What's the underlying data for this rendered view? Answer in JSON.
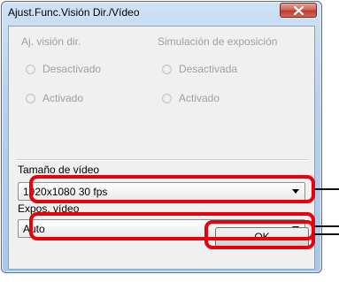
{
  "window": {
    "title": "Ajust.Func.Visión Dir./Vídeo",
    "close_icon": "close-icon"
  },
  "aj_vision": {
    "label": "Aj. visión dir.",
    "options": [
      "Desactivado",
      "Activado"
    ],
    "enabled": false
  },
  "simulacion": {
    "label": "Simulación de exposición",
    "options": [
      "Desactivada",
      "Activado"
    ],
    "enabled": false
  },
  "video_size": {
    "label": "Tamaño de vídeo",
    "value": "1920x1080  30 fps"
  },
  "video_exposure": {
    "label": "Expos. vídeo",
    "value": "Auto"
  },
  "ok_button": {
    "label": "OK"
  },
  "highlight_color": "#e8000b"
}
